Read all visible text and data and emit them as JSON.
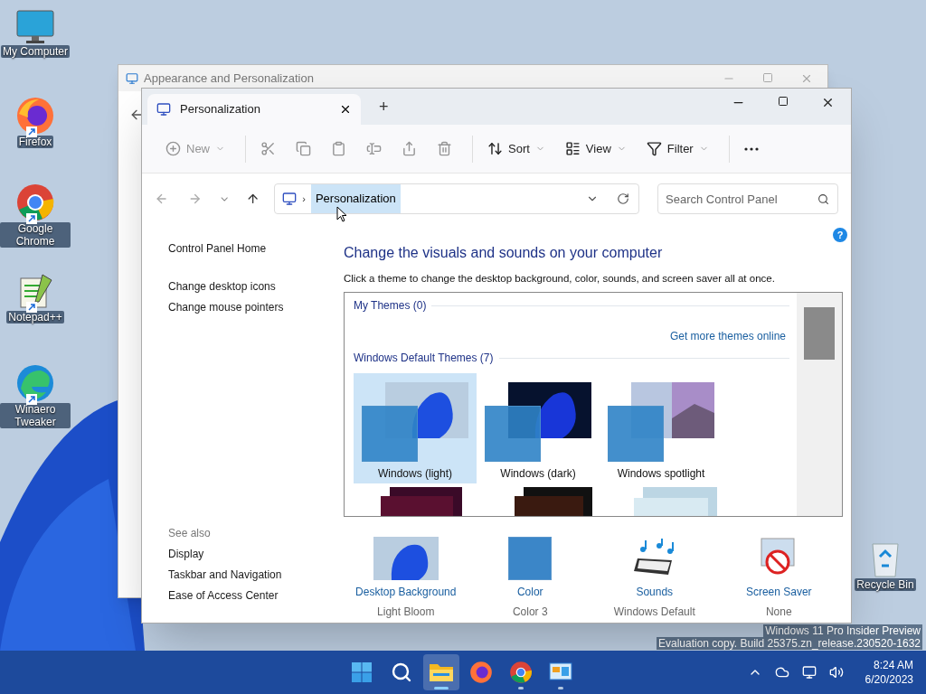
{
  "desktop_icons": [
    {
      "kind": "computer",
      "label": "My Computer",
      "shortcut": false
    },
    {
      "kind": "firefox",
      "label": "Firefox",
      "shortcut": true
    },
    {
      "kind": "chrome",
      "label": "Google Chrome",
      "shortcut": true
    },
    {
      "kind": "notepad",
      "label": "Notepad++",
      "shortcut": true
    },
    {
      "kind": "edge",
      "label": "Winaero Tweaker",
      "shortcut": true
    },
    {
      "kind": "recycle",
      "label": "Recycle Bin",
      "shortcut": false
    }
  ],
  "back_window": {
    "title": "Appearance and Personalization"
  },
  "window": {
    "tabs": [
      {
        "title": "Personalization",
        "selected": true
      }
    ],
    "new_tab": "+",
    "toolbar": [
      {
        "kind": "new",
        "label": "New",
        "disabled": true
      },
      {
        "kind": "cut",
        "disabled": true
      },
      {
        "kind": "copy",
        "disabled": true
      },
      {
        "kind": "paste",
        "disabled": true
      },
      {
        "kind": "rename",
        "disabled": true
      },
      {
        "kind": "share",
        "disabled": true
      },
      {
        "kind": "delete",
        "disabled": true
      },
      {
        "kind": "sort",
        "label": "Sort",
        "disabled": false
      },
      {
        "kind": "view",
        "label": "View",
        "disabled": false
      },
      {
        "kind": "filter",
        "label": "Filter",
        "disabled": false
      },
      {
        "kind": "more",
        "disabled": false
      }
    ],
    "address": {
      "separator": "›",
      "crumbs": [
        "Personalization"
      ],
      "search_placeholder": "Search Control Panel"
    },
    "help": "?",
    "sidebar": {
      "home": "Control Panel Home",
      "links": [
        "Change desktop icons",
        "Change mouse pointers"
      ],
      "see_also_heading": "See also",
      "see_also": [
        "Display",
        "Taskbar and Navigation",
        "Ease of Access Center"
      ]
    },
    "main": {
      "heading": "Change the visuals and sounds on your computer",
      "description": "Click a theme to change the desktop background, color, sounds, and screen saver all at once.",
      "my_themes": "My Themes (0)",
      "get_more": "Get more themes online",
      "default_themes": "Windows Default Themes (7)",
      "themes": [
        {
          "kind": "light",
          "name": "Windows (light)",
          "selected": true
        },
        {
          "kind": "dark",
          "name": "Windows (dark)",
          "selected": false
        },
        {
          "kind": "spotlight",
          "name": "Windows spotlight",
          "selected": false
        }
      ],
      "bottom": [
        {
          "kind": "background",
          "label": "Desktop Background",
          "value": "Light Bloom"
        },
        {
          "kind": "color",
          "label": "Color",
          "value": "Color 3"
        },
        {
          "kind": "sounds",
          "label": "Sounds",
          "value": "Windows Default"
        },
        {
          "kind": "screensaver",
          "label": "Screen Saver",
          "value": "None"
        }
      ]
    }
  },
  "watermark": [
    "Windows 11 Pro Insider Preview",
    "Evaluation copy. Build 25375.zn_release.230520-1632"
  ],
  "taskbar": {
    "apps": [
      {
        "kind": "start",
        "active": false,
        "running": false
      },
      {
        "kind": "search",
        "active": false,
        "running": false
      },
      {
        "kind": "explorer",
        "active": true,
        "running": true
      },
      {
        "kind": "firefox",
        "active": false,
        "running": false
      },
      {
        "kind": "chrome",
        "active": false,
        "running": true
      },
      {
        "kind": "controlpanel",
        "active": false,
        "running": true
      }
    ],
    "time": "8:24 AM",
    "date": "6/20/2023"
  }
}
